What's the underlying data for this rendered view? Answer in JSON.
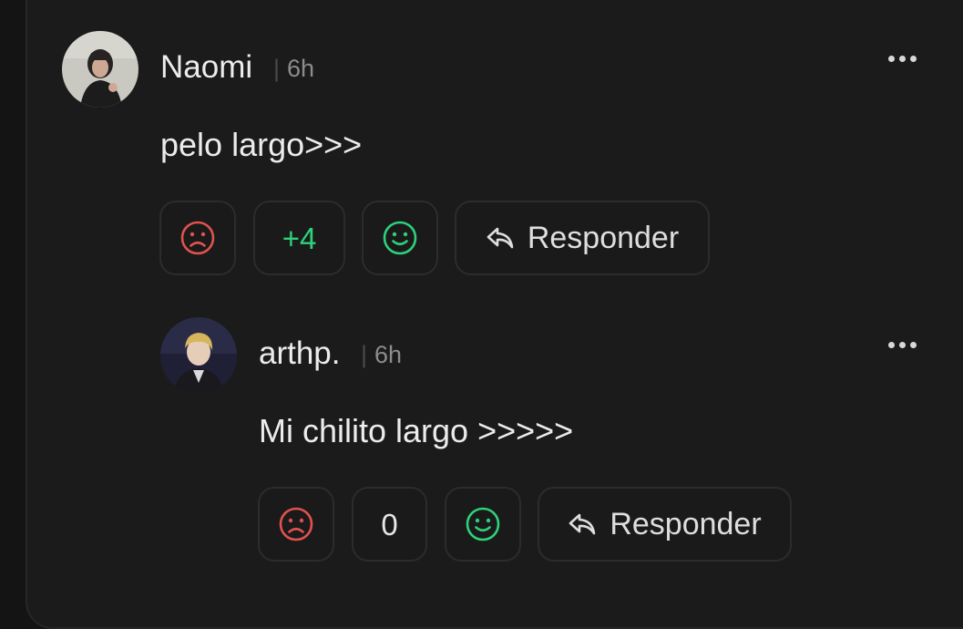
{
  "colors": {
    "background": "#141414",
    "card": "#1b1b1b",
    "dislike": "#e0524f",
    "like": "#2fd07a",
    "score_positive": "#2fd07a",
    "score_neutral": "#e6e6e6"
  },
  "comments": [
    {
      "author": "Naomi",
      "separator": "|",
      "time": "6h",
      "text": "pelo largo>>>",
      "score": "+4",
      "reply_label": "Responder",
      "icons": {
        "dislike": "sad-face-icon",
        "like": "smile-face-icon",
        "reply": "reply-arrow-icon",
        "more": "more-dots-icon"
      }
    },
    {
      "author": "arthp.",
      "separator": "|",
      "time": "6h",
      "text": "Mi chilito largo >>>>>",
      "score": "0",
      "reply_label": "Responder",
      "icons": {
        "dislike": "sad-face-icon",
        "like": "smile-face-icon",
        "reply": "reply-arrow-icon",
        "more": "more-dots-icon"
      }
    }
  ]
}
